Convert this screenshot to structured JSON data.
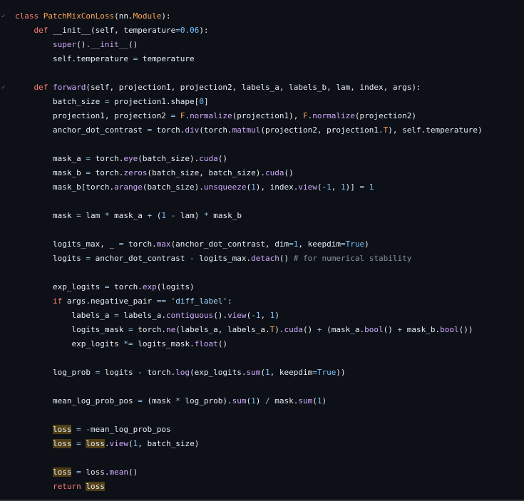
{
  "colors": {
    "background": "#0d1117",
    "keyword": "#ff7b72",
    "function": "#d2a8ff",
    "class": "#ffa657",
    "number": "#79c0ff",
    "string": "#a5d6ff",
    "comment": "#8b949e",
    "highlight": "#4f3d14"
  },
  "fold_icon": "check-fold-icon",
  "code_lines": [
    {
      "fold": true,
      "indent": 0,
      "tokens": [
        [
          "k",
          "class "
        ],
        [
          "c",
          "PatchMixConLoss"
        ],
        [
          "t",
          "(nn."
        ],
        [
          "c",
          "Module"
        ],
        [
          "t",
          "):"
        ]
      ]
    },
    {
      "indent": 1,
      "tokens": [
        [
          "k",
          "def "
        ],
        [
          "t",
          "__init__(self, temperature"
        ],
        [
          "o",
          "="
        ],
        [
          "n",
          "0.06"
        ],
        [
          "t",
          "):"
        ]
      ]
    },
    {
      "indent": 2,
      "tokens": [
        [
          "f",
          "super"
        ],
        [
          "t",
          "()."
        ],
        [
          "f",
          "__init__"
        ],
        [
          "t",
          "()"
        ]
      ]
    },
    {
      "indent": 2,
      "tokens": [
        [
          "t",
          "self.temperature "
        ],
        [
          "o",
          "="
        ],
        [
          "t",
          " temperature"
        ]
      ]
    },
    {
      "indent": 0,
      "tokens": []
    },
    {
      "fold": true,
      "indent": 1,
      "tokens": [
        [
          "k",
          "def "
        ],
        [
          "f",
          "forward"
        ],
        [
          "t",
          "(self, projection1, projection2, labels_a, labels_b, lam, index, args):"
        ]
      ]
    },
    {
      "indent": 2,
      "tokens": [
        [
          "t",
          "batch_size "
        ],
        [
          "o",
          "="
        ],
        [
          "t",
          " projection1.shape["
        ],
        [
          "n",
          "0"
        ],
        [
          "t",
          "]"
        ]
      ]
    },
    {
      "indent": 2,
      "tokens": [
        [
          "t",
          "projection1, projection2 "
        ],
        [
          "o",
          "="
        ],
        [
          "t",
          " "
        ],
        [
          "c",
          "F"
        ],
        [
          "t",
          "."
        ],
        [
          "f",
          "normalize"
        ],
        [
          "t",
          "(projection1), "
        ],
        [
          "c",
          "F"
        ],
        [
          "t",
          "."
        ],
        [
          "f",
          "normalize"
        ],
        [
          "t",
          "(projection2)"
        ]
      ]
    },
    {
      "indent": 2,
      "tokens": [
        [
          "t",
          "anchor_dot_contrast "
        ],
        [
          "o",
          "="
        ],
        [
          "t",
          " torch."
        ],
        [
          "f",
          "div"
        ],
        [
          "t",
          "(torch."
        ],
        [
          "f",
          "matmul"
        ],
        [
          "t",
          "(projection2, projection1."
        ],
        [
          "c",
          "T"
        ],
        [
          "t",
          "), self.temperature)"
        ]
      ]
    },
    {
      "indent": 0,
      "tokens": []
    },
    {
      "indent": 2,
      "tokens": [
        [
          "t",
          "mask_a "
        ],
        [
          "o",
          "="
        ],
        [
          "t",
          " torch."
        ],
        [
          "f",
          "eye"
        ],
        [
          "t",
          "(batch_size)."
        ],
        [
          "f",
          "cuda"
        ],
        [
          "t",
          "()"
        ]
      ]
    },
    {
      "indent": 2,
      "tokens": [
        [
          "t",
          "mask_b "
        ],
        [
          "o",
          "="
        ],
        [
          "t",
          " torch."
        ],
        [
          "f",
          "zeros"
        ],
        [
          "t",
          "(batch_size, batch_size)."
        ],
        [
          "f",
          "cuda"
        ],
        [
          "t",
          "()"
        ]
      ]
    },
    {
      "indent": 2,
      "tokens": [
        [
          "t",
          "mask_b[torch."
        ],
        [
          "f",
          "arange"
        ],
        [
          "t",
          "(batch_size)."
        ],
        [
          "f",
          "unsqueeze"
        ],
        [
          "t",
          "("
        ],
        [
          "n",
          "1"
        ],
        [
          "t",
          "), index."
        ],
        [
          "f",
          "view"
        ],
        [
          "t",
          "("
        ],
        [
          "o",
          "-"
        ],
        [
          "n",
          "1"
        ],
        [
          "t",
          ", "
        ],
        [
          "n",
          "1"
        ],
        [
          "t",
          ")] "
        ],
        [
          "o",
          "="
        ],
        [
          "t",
          " "
        ],
        [
          "n",
          "1"
        ]
      ]
    },
    {
      "indent": 0,
      "tokens": []
    },
    {
      "indent": 2,
      "tokens": [
        [
          "t",
          "mask "
        ],
        [
          "o",
          "="
        ],
        [
          "t",
          " lam "
        ],
        [
          "o",
          "*"
        ],
        [
          "t",
          " mask_a "
        ],
        [
          "o",
          "+"
        ],
        [
          "t",
          " ("
        ],
        [
          "n",
          "1"
        ],
        [
          "t",
          " "
        ],
        [
          "o",
          "-"
        ],
        [
          "t",
          " lam) "
        ],
        [
          "o",
          "*"
        ],
        [
          "t",
          " mask_b"
        ]
      ]
    },
    {
      "indent": 0,
      "tokens": []
    },
    {
      "indent": 2,
      "tokens": [
        [
          "t",
          "logits_max, _ "
        ],
        [
          "o",
          "="
        ],
        [
          "t",
          " torch."
        ],
        [
          "f",
          "max"
        ],
        [
          "t",
          "(anchor_dot_contrast, dim"
        ],
        [
          "o",
          "="
        ],
        [
          "n",
          "1"
        ],
        [
          "t",
          ", keepdim"
        ],
        [
          "o",
          "="
        ],
        [
          "n",
          "True"
        ],
        [
          "t",
          ")"
        ]
      ]
    },
    {
      "indent": 2,
      "tokens": [
        [
          "t",
          "logits "
        ],
        [
          "o",
          "="
        ],
        [
          "t",
          " anchor_dot_contrast "
        ],
        [
          "o",
          "-"
        ],
        [
          "t",
          " logits_max."
        ],
        [
          "f",
          "detach"
        ],
        [
          "t",
          "() "
        ],
        [
          "m",
          "# for numerical stability"
        ]
      ]
    },
    {
      "indent": 0,
      "tokens": []
    },
    {
      "indent": 2,
      "tokens": [
        [
          "t",
          "exp_logits "
        ],
        [
          "o",
          "="
        ],
        [
          "t",
          " torch."
        ],
        [
          "f",
          "exp"
        ],
        [
          "t",
          "(logits)"
        ]
      ]
    },
    {
      "indent": 2,
      "tokens": [
        [
          "k",
          "if "
        ],
        [
          "t",
          "args.negative_pair "
        ],
        [
          "o",
          "=="
        ],
        [
          "t",
          " "
        ],
        [
          "s",
          "'diff_label'"
        ],
        [
          "t",
          ":"
        ]
      ]
    },
    {
      "indent": 3,
      "tokens": [
        [
          "t",
          "labels_a "
        ],
        [
          "o",
          "="
        ],
        [
          "t",
          " labels_a."
        ],
        [
          "f",
          "contiguous"
        ],
        [
          "t",
          "()."
        ],
        [
          "f",
          "view"
        ],
        [
          "t",
          "("
        ],
        [
          "o",
          "-"
        ],
        [
          "n",
          "1"
        ],
        [
          "t",
          ", "
        ],
        [
          "n",
          "1"
        ],
        [
          "t",
          ")"
        ]
      ]
    },
    {
      "indent": 3,
      "tokens": [
        [
          "t",
          "logits_mask "
        ],
        [
          "o",
          "="
        ],
        [
          "t",
          " torch."
        ],
        [
          "f",
          "ne"
        ],
        [
          "t",
          "(labels_a, labels_a."
        ],
        [
          "c",
          "T"
        ],
        [
          "t",
          ")."
        ],
        [
          "f",
          "cuda"
        ],
        [
          "t",
          "() "
        ],
        [
          "o",
          "+"
        ],
        [
          "t",
          " (mask_a."
        ],
        [
          "f",
          "bool"
        ],
        [
          "t",
          "() "
        ],
        [
          "o",
          "+"
        ],
        [
          "t",
          " mask_b."
        ],
        [
          "f",
          "bool"
        ],
        [
          "t",
          "())"
        ]
      ]
    },
    {
      "indent": 3,
      "tokens": [
        [
          "t",
          "exp_logits "
        ],
        [
          "o",
          "*="
        ],
        [
          "t",
          " logits_mask."
        ],
        [
          "f",
          "float"
        ],
        [
          "t",
          "()"
        ]
      ]
    },
    {
      "indent": 0,
      "tokens": []
    },
    {
      "indent": 2,
      "tokens": [
        [
          "t",
          "log_prob "
        ],
        [
          "o",
          "="
        ],
        [
          "t",
          " logits "
        ],
        [
          "o",
          "-"
        ],
        [
          "t",
          " torch."
        ],
        [
          "f",
          "log"
        ],
        [
          "t",
          "(exp_logits."
        ],
        [
          "f",
          "sum"
        ],
        [
          "t",
          "("
        ],
        [
          "n",
          "1"
        ],
        [
          "t",
          ", keepdim"
        ],
        [
          "o",
          "="
        ],
        [
          "n",
          "True"
        ],
        [
          "t",
          "))"
        ]
      ]
    },
    {
      "indent": 0,
      "tokens": []
    },
    {
      "indent": 2,
      "tokens": [
        [
          "t",
          "mean_log_prob_pos "
        ],
        [
          "o",
          "="
        ],
        [
          "t",
          " (mask "
        ],
        [
          "o",
          "*"
        ],
        [
          "t",
          " log_prob)."
        ],
        [
          "f",
          "sum"
        ],
        [
          "t",
          "("
        ],
        [
          "n",
          "1"
        ],
        [
          "t",
          ") "
        ],
        [
          "o",
          "/"
        ],
        [
          "t",
          " mask."
        ],
        [
          "f",
          "sum"
        ],
        [
          "t",
          "("
        ],
        [
          "n",
          "1"
        ],
        [
          "t",
          ")"
        ]
      ]
    },
    {
      "indent": 0,
      "tokens": []
    },
    {
      "indent": 2,
      "tokens": [
        [
          "h",
          "loss"
        ],
        [
          "t",
          " "
        ],
        [
          "o",
          "="
        ],
        [
          "t",
          " "
        ],
        [
          "o",
          "-"
        ],
        [
          "t",
          "mean_log_prob_pos"
        ]
      ]
    },
    {
      "indent": 2,
      "tokens": [
        [
          "h",
          "loss"
        ],
        [
          "t",
          " "
        ],
        [
          "o",
          "="
        ],
        [
          "t",
          " "
        ],
        [
          "h",
          "loss"
        ],
        [
          "t",
          "."
        ],
        [
          "f",
          "view"
        ],
        [
          "t",
          "("
        ],
        [
          "n",
          "1"
        ],
        [
          "t",
          ", batch_size)"
        ]
      ]
    },
    {
      "indent": 0,
      "tokens": []
    },
    {
      "indent": 2,
      "tokens": [
        [
          "h",
          "loss"
        ],
        [
          "t",
          " "
        ],
        [
          "o",
          "="
        ],
        [
          "t",
          " loss."
        ],
        [
          "f",
          "mean"
        ],
        [
          "t",
          "()"
        ]
      ]
    },
    {
      "indent": 2,
      "tokens": [
        [
          "k",
          "return "
        ],
        [
          "h",
          "loss"
        ]
      ]
    }
  ]
}
